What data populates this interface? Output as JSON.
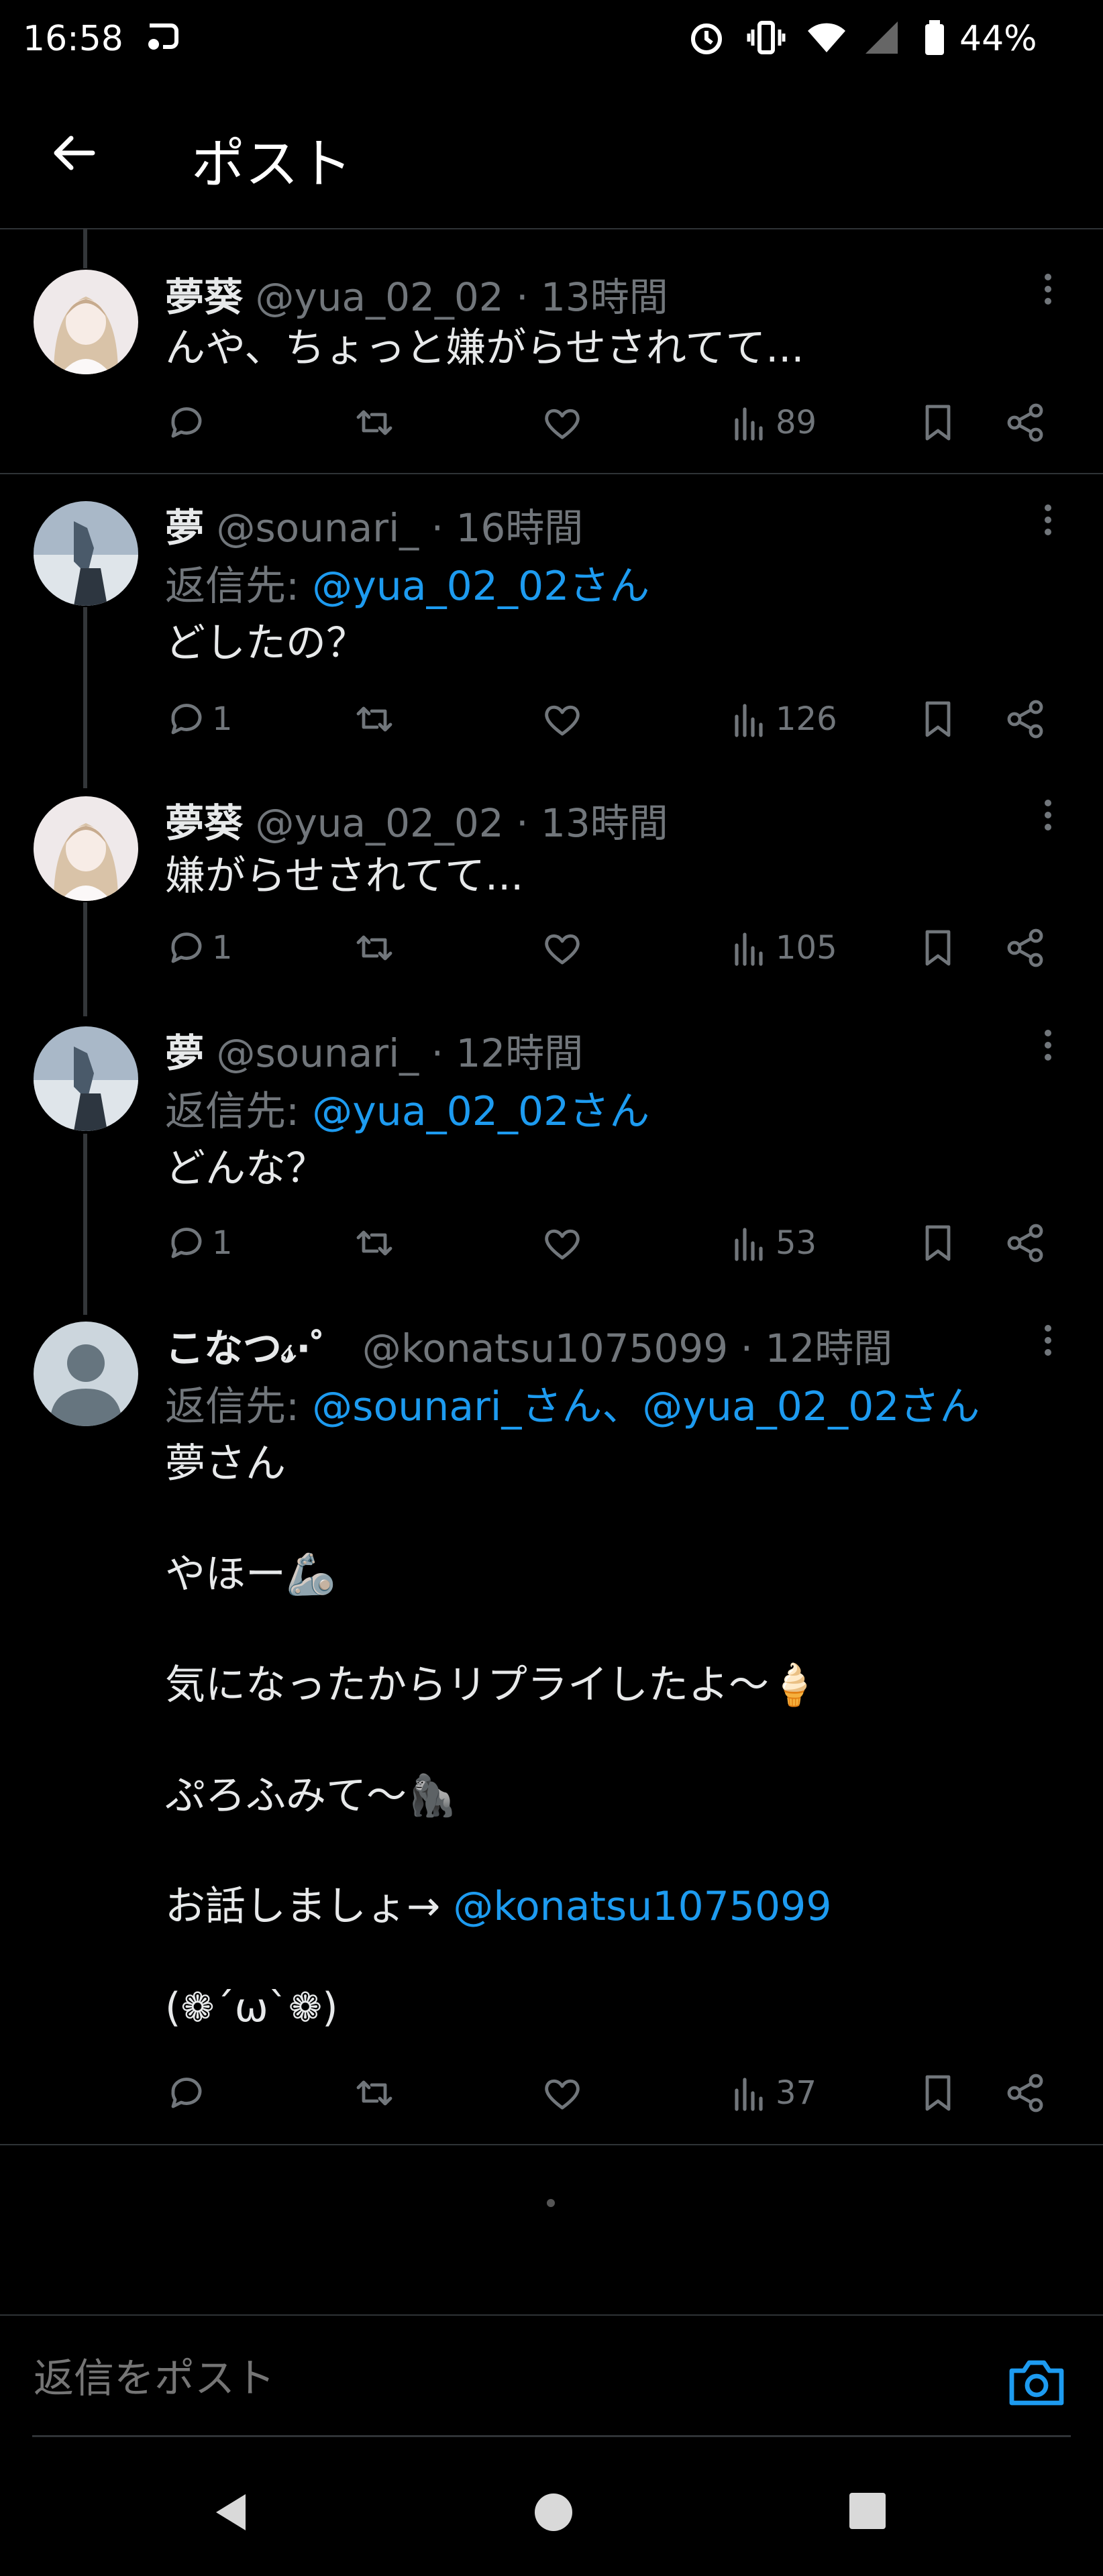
{
  "status_bar": {
    "time": "16:58",
    "battery_percent": "44%"
  },
  "header": {
    "title": "ポスト"
  },
  "posts": [
    {
      "name": "夢葵",
      "handle": "@yua_02_02",
      "time": "13時間",
      "lines": [
        "んや、ちょっと嫌がらせされてて..."
      ],
      "replies": "",
      "views": "89"
    },
    {
      "name": "夢",
      "handle": "@sounari_",
      "time": "16時間",
      "reply_to_label": "返信先:",
      "reply_to": "@yua_02_02さん",
      "lines": [
        "どしたの？"
      ],
      "replies": "1",
      "views": "126"
    },
    {
      "name": "夢葵",
      "handle": "@yua_02_02",
      "time": "13時間",
      "lines": [
        "嫌がらせされてて..."
      ],
      "replies": "1",
      "views": "105"
    },
    {
      "name": "夢",
      "handle": "@sounari_",
      "time": "12時間",
      "reply_to_label": "返信先:",
      "reply_to": "@yua_02_02さん",
      "lines": [
        "どんな？"
      ],
      "replies": "1",
      "views": "53"
    },
    {
      "name": "こなつ𝓈·゜",
      "handle": "@konatsu1075099",
      "time": "12時間",
      "reply_to_label": "返信先:",
      "reply_to": "@sounari_さん、@yua_02_02さん",
      "lines": [
        "夢さん",
        "やほー🦾",
        "気になったからリプライしたよ〜🍦",
        "ぷろふみて〜🦍",
        "お話しましょ→",
        "(❁´ω`❁)"
      ],
      "mention_link": "@konatsu1075099",
      "replies": "",
      "views": "37"
    }
  ],
  "reply_box": {
    "placeholder": "返信をポスト"
  },
  "colors": {
    "background": "#000000",
    "text": "#e7e9ea",
    "secondary": "#71767b",
    "accent": "#1d9bf0",
    "divider": "#2f3336"
  }
}
